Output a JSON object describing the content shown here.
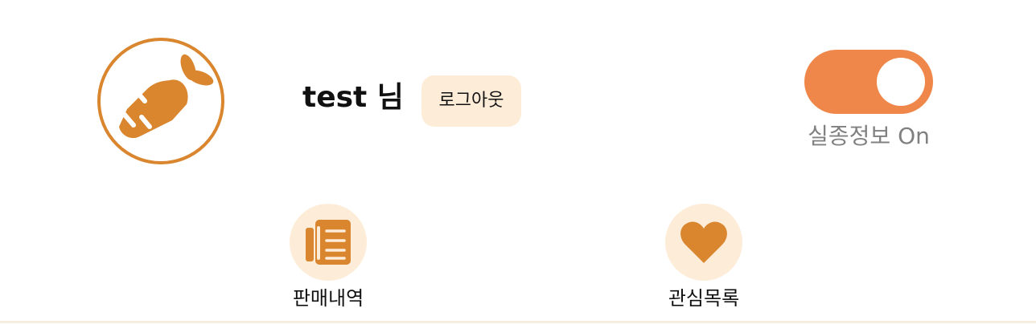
{
  "profile": {
    "avatar_icon": "carrot-icon",
    "username": "test 님",
    "logout_label": "로그아웃"
  },
  "toggle": {
    "state": "on",
    "label": "실종정보 On"
  },
  "menu": {
    "items": [
      {
        "icon": "document-list-icon",
        "label": "판매내역"
      },
      {
        "icon": "heart-icon",
        "label": "관심목록"
      }
    ]
  },
  "colors": {
    "accent": "#d9862f",
    "toggle_on": "#f0874a",
    "soft_bg": "#fdecd8",
    "muted_text": "#808080"
  }
}
